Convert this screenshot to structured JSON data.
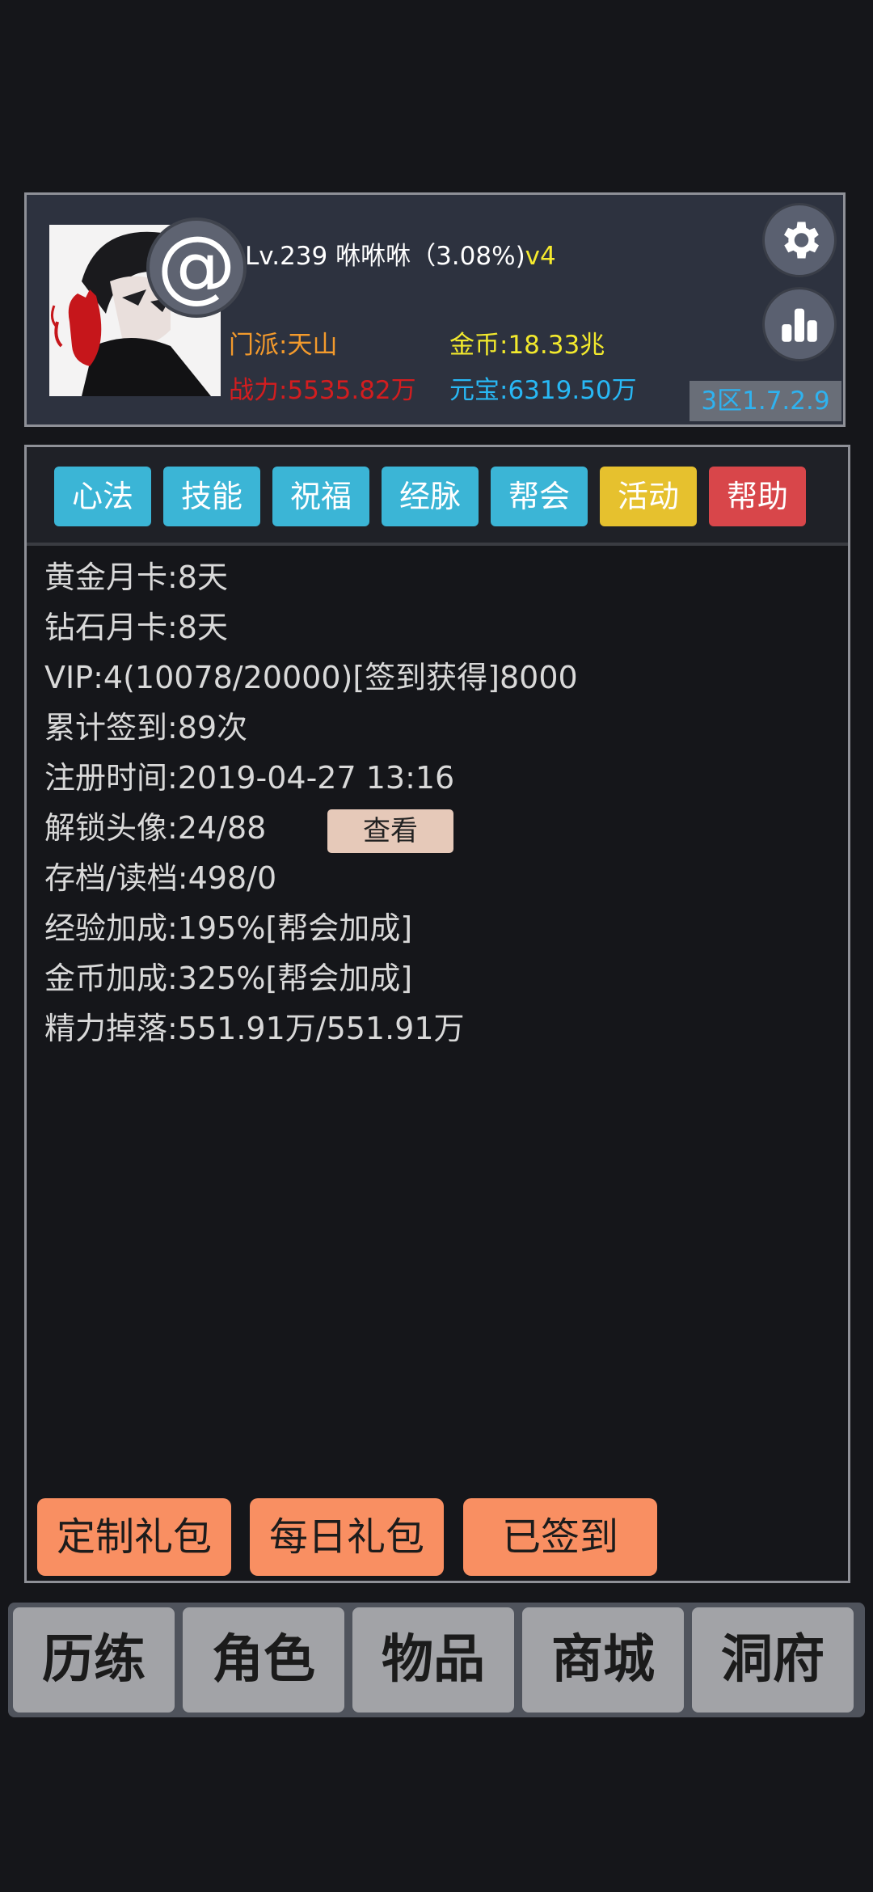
{
  "header": {
    "avatar_badge": "@",
    "level_text": "Lv.239 咻咻咻（3.08%)",
    "vip_text": "v4",
    "sect": "门派:天山",
    "power": "战力:5535.82万",
    "gold": "金币:18.33兆",
    "ingot": "元宝:6319.50万",
    "server_version": "3区1.7.2.9",
    "settings_icon": "gear-icon",
    "stats_icon": "bar-chart-icon"
  },
  "tabs": [
    {
      "label": "心法",
      "color": "#3bb5d6"
    },
    {
      "label": "技能",
      "color": "#3bb5d6"
    },
    {
      "label": "祝福",
      "color": "#3bb5d6"
    },
    {
      "label": "经脉",
      "color": "#3bb5d6"
    },
    {
      "label": "帮会",
      "color": "#3bb5d6"
    },
    {
      "label": "活动",
      "color": "#e6c12e"
    },
    {
      "label": "帮助",
      "color": "#d8464a"
    }
  ],
  "info": {
    "gold_card": "黄金月卡:8天",
    "diamond_card": "钻石月卡:8天",
    "vip": "VIP:4(10078/20000)[签到获得]8000",
    "sign_in_total": "累计签到:89次",
    "register_time": "注册时间:2019-04-27 13:16",
    "avatars_unlocked": "解锁头像:24/88",
    "view_button": "查看",
    "save_load": "存档/读档:498/0",
    "exp_bonus": "经验加成:195%[帮会加成]",
    "gold_bonus": "金币加成:325%[帮会加成]",
    "energy_drop": "精力掉落:551.91万/551.91万"
  },
  "gift_buttons": {
    "custom_pack": "定制礼包",
    "daily_pack": "每日礼包",
    "signed_in": "已签到"
  },
  "bottom_nav": [
    "历练",
    "角色",
    "物品",
    "商城",
    "洞府"
  ]
}
